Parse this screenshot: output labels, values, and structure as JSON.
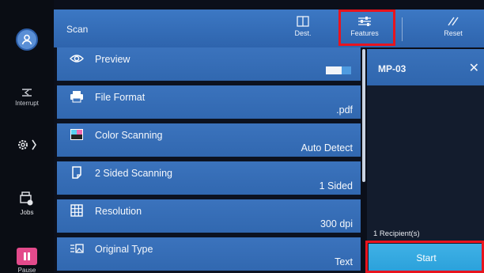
{
  "rail": {
    "avatar_icon": "user-icon",
    "interrupt_label": "Interrupt",
    "settings_icon": "gear-icon",
    "jobs_label": "Jobs",
    "pause_label": "Pause"
  },
  "header": {
    "title": "Scan",
    "dest_label": "Dest.",
    "features_label": "Features",
    "reset_label": "Reset"
  },
  "features": [
    {
      "label": "Preview",
      "value": "",
      "icon": "eye-icon"
    },
    {
      "label": "File Format",
      "value": ".pdf",
      "icon": "printer-icon"
    },
    {
      "label": "Color Scanning",
      "value": "Auto Detect",
      "icon": "color-swatch-icon"
    },
    {
      "label": "2 Sided Scanning",
      "value": "1 Sided",
      "icon": "page-icon"
    },
    {
      "label": "Resolution",
      "value": "300 dpi",
      "icon": "grid-icon"
    },
    {
      "label": "Original Type",
      "value": "Text",
      "icon": "original-type-icon"
    }
  ],
  "preview_toggle": {
    "on": false
  },
  "panel": {
    "title": "MP-03",
    "recipients": "1 Recipient(s)",
    "start_label": "Start"
  },
  "colors": {
    "accent_blue": "#3b73bd",
    "start_blue": "#2aa0da",
    "highlight_red": "#e8141e",
    "pause_pink": "#e34a8b"
  }
}
